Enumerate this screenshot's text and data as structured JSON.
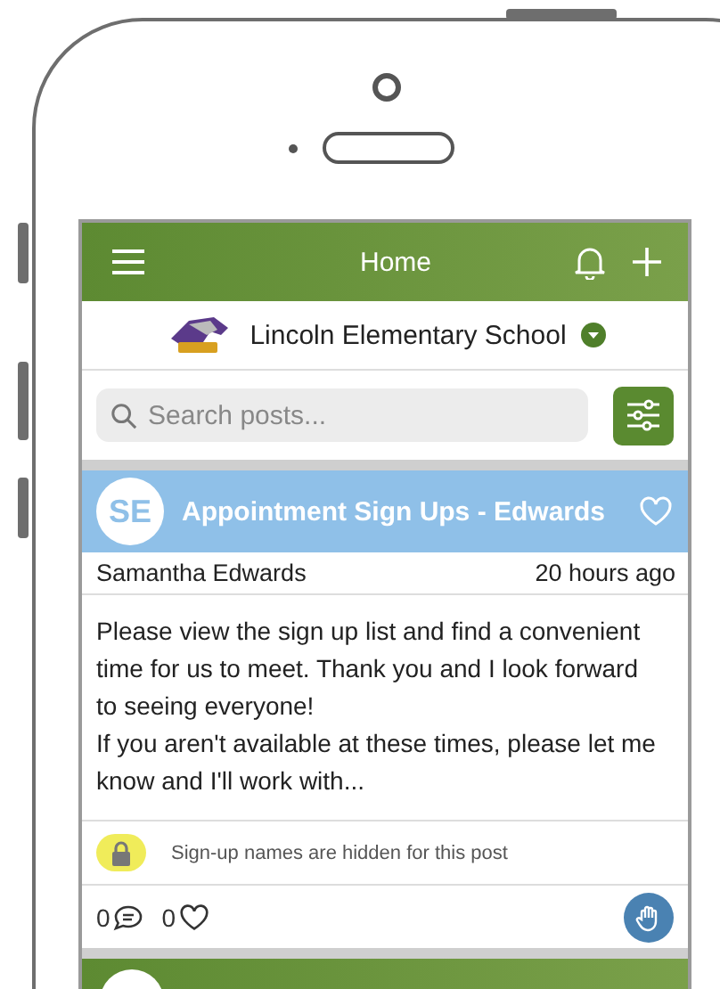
{
  "header": {
    "title": "Home"
  },
  "school": {
    "name": "Lincoln Elementary School"
  },
  "search": {
    "placeholder": "Search posts..."
  },
  "posts": [
    {
      "avatar": "SE",
      "title": "Appointment Sign Ups - Edwards",
      "author": "Samantha Edwards",
      "time": "20 hours ago",
      "body": [
        "Please view the sign up list and find a convenient time for us to meet. Thank you and I look forward to seeing everyone!",
        "If you aren't available at these times, please let me know and I'll work with..."
      ],
      "note": "Sign-up names are hidden for this post",
      "comments": "0",
      "likes": "0"
    }
  ]
}
